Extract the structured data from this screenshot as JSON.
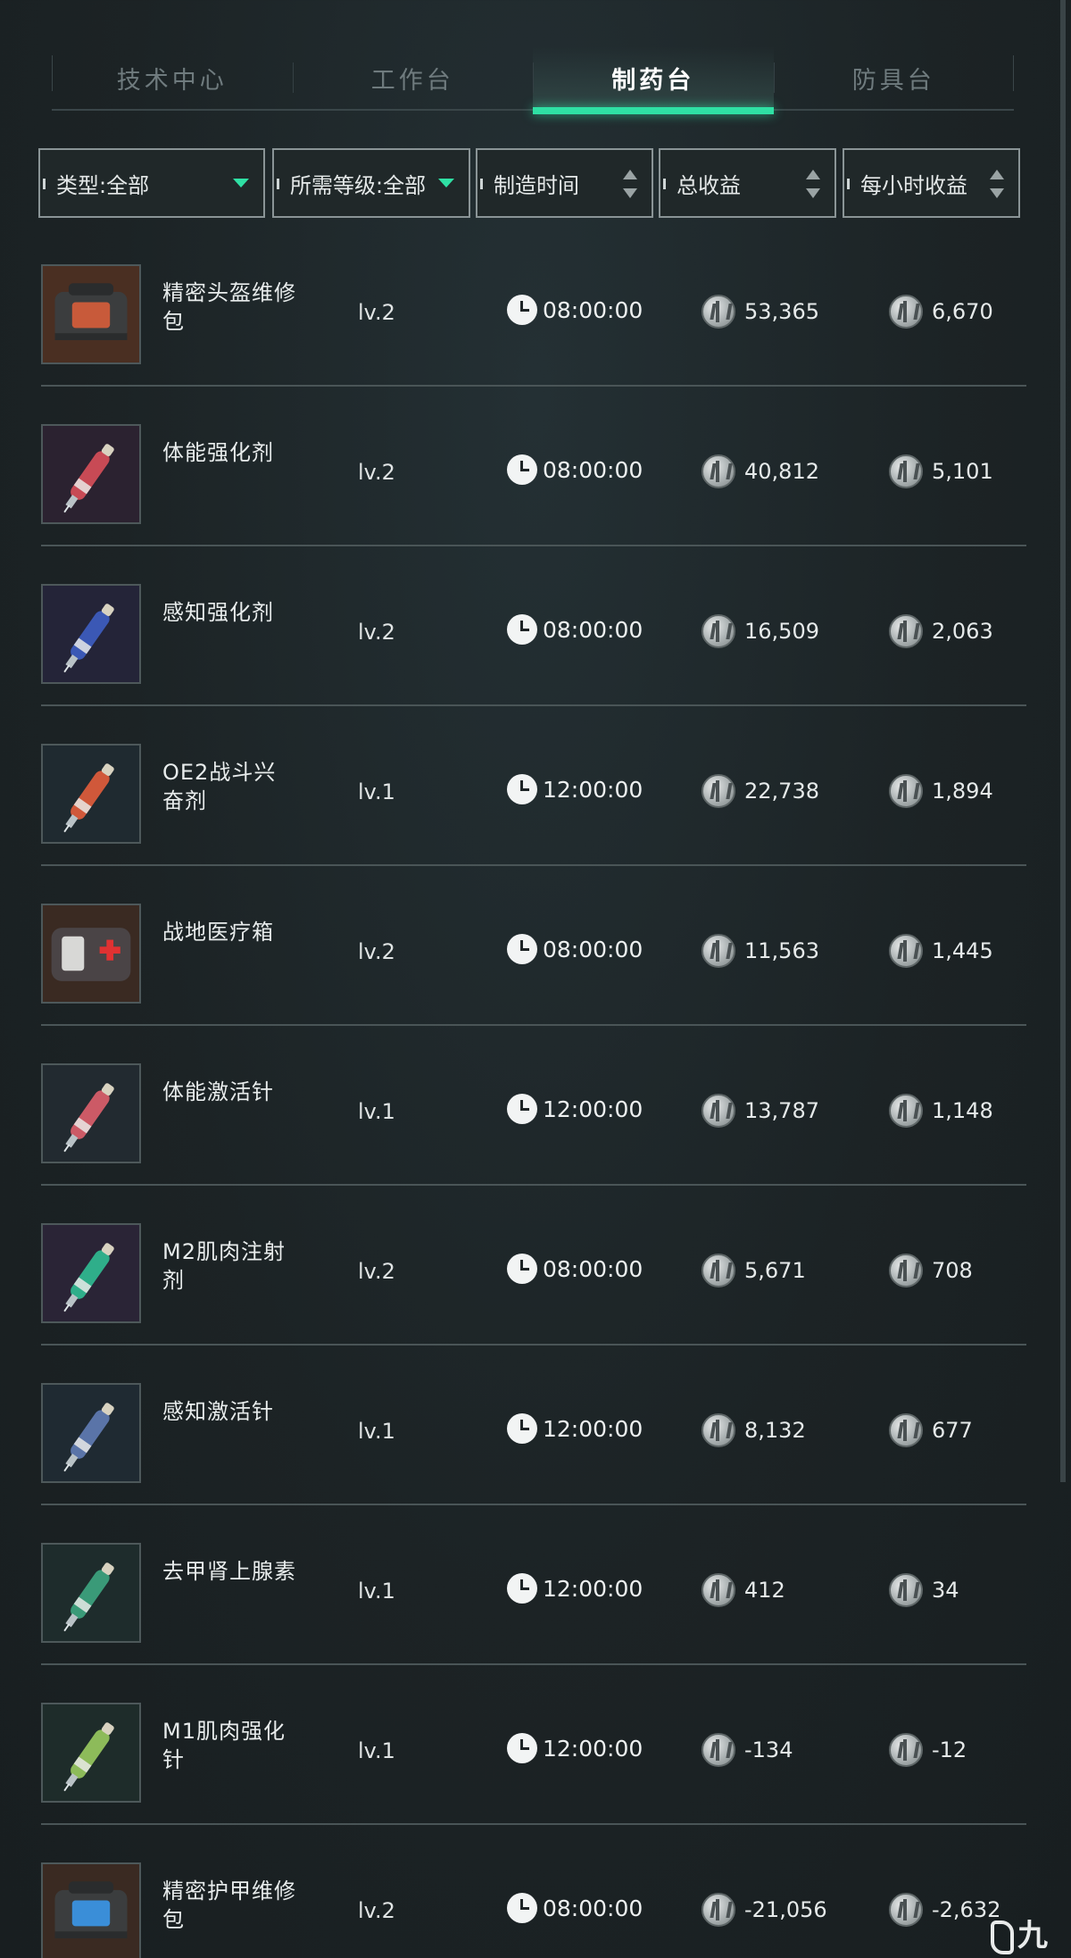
{
  "tabs": [
    {
      "label": "技术中心",
      "active": false
    },
    {
      "label": "工作台",
      "active": false
    },
    {
      "label": "制药台",
      "active": true
    },
    {
      "label": "防具台",
      "active": false
    }
  ],
  "filters": {
    "type": "类型:全部",
    "level": "所需等级:全部",
    "craft_time": "制造时间",
    "total_profit": "总收益",
    "hourly_profit": "每小时收益"
  },
  "colors": {
    "accent": "#2fe0a4",
    "background": "#1d2426"
  },
  "items": [
    {
      "name": "精密头盔维修包",
      "level": "lv.2",
      "time": "08:00:00",
      "total": "53,365",
      "hourly": "6,670",
      "icon": "repair-kit-icon"
    },
    {
      "name": "体能强化剂",
      "level": "lv.2",
      "time": "08:00:00",
      "total": "40,812",
      "hourly": "5,101",
      "icon": "syringe-red-icon"
    },
    {
      "name": "感知强化剂",
      "level": "lv.2",
      "time": "08:00:00",
      "total": "16,509",
      "hourly": "2,063",
      "icon": "syringe-blue-icon"
    },
    {
      "name": "OE2战斗兴奋剂",
      "level": "lv.1",
      "time": "12:00:00",
      "total": "22,738",
      "hourly": "1,894",
      "icon": "syringe-orange-icon"
    },
    {
      "name": "战地医疗箱",
      "level": "lv.2",
      "time": "08:00:00",
      "total": "11,563",
      "hourly": "1,445",
      "icon": "medkit-icon"
    },
    {
      "name": "体能激活针",
      "level": "lv.1",
      "time": "12:00:00",
      "total": "13,787",
      "hourly": "1,148",
      "icon": "syringe-pink-icon"
    },
    {
      "name": "M2肌肉注射剂",
      "level": "lv.2",
      "time": "08:00:00",
      "total": "5,671",
      "hourly": "708",
      "icon": "syringe-green-icon"
    },
    {
      "name": "感知激活针",
      "level": "lv.1",
      "time": "12:00:00",
      "total": "8,132",
      "hourly": "677",
      "icon": "syringe-slate-icon"
    },
    {
      "name": "去甲肾上腺素",
      "level": "lv.1",
      "time": "12:00:00",
      "total": "412",
      "hourly": "34",
      "icon": "syringe-teal-icon"
    },
    {
      "name": "M1肌肉强化针",
      "level": "lv.1",
      "time": "12:00:00",
      "total": "-134",
      "hourly": "-12",
      "icon": "syringe-lime-icon"
    },
    {
      "name": "精密护甲维修包",
      "level": "lv.2",
      "time": "08:00:00",
      "total": "-21,056",
      "hourly": "-2,632",
      "icon": "armor-repair-kit-icon"
    }
  ],
  "watermark": "九游"
}
